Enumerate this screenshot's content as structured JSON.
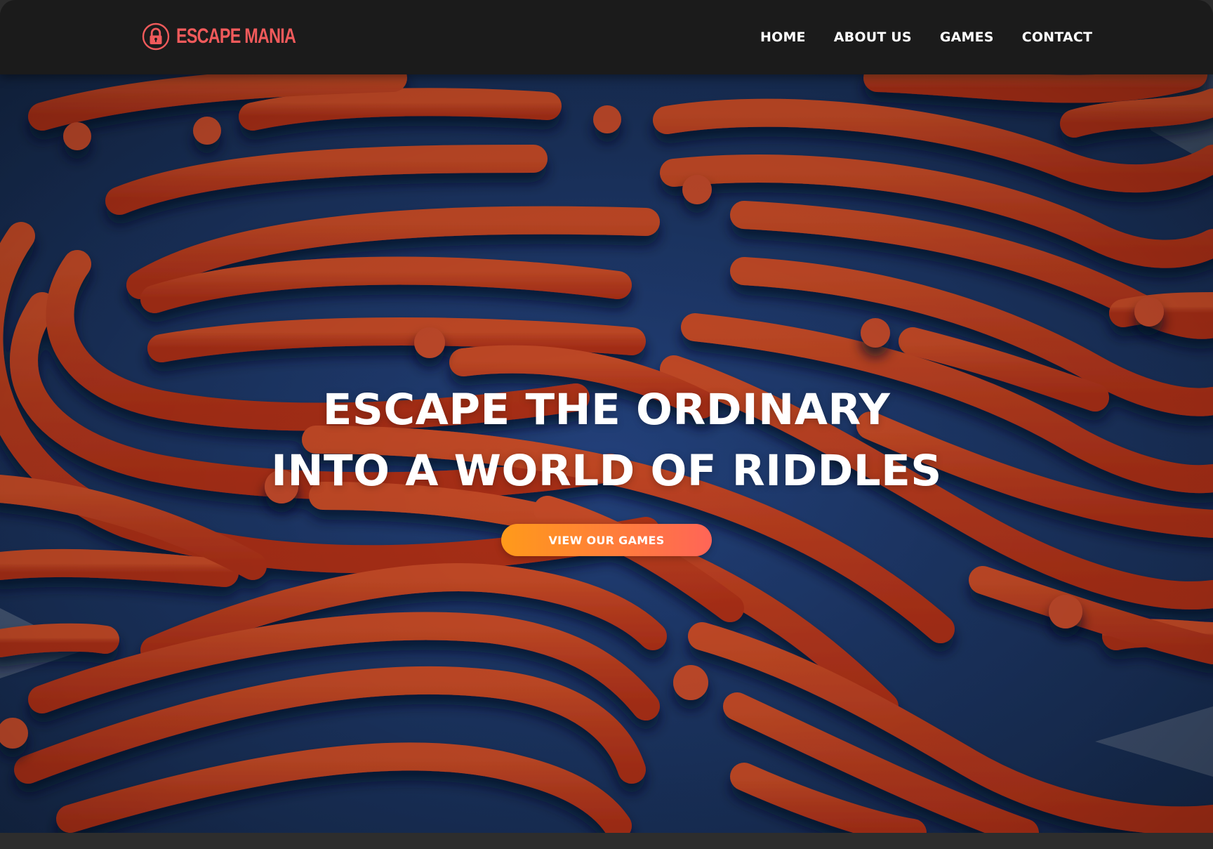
{
  "brand": {
    "name": "ESCAPE MANIA",
    "icon": "padlock-icon",
    "color": "#f05a5b"
  },
  "nav": {
    "items": [
      {
        "label": "HOME"
      },
      {
        "label": "ABOUT US"
      },
      {
        "label": "GAMES"
      },
      {
        "label": "CONTACT"
      }
    ]
  },
  "hero": {
    "background": "maze-fingerprint-pattern",
    "title_line1": "ESCAPE THE ORDINARY",
    "title_line2": "INTO A WORLD OF RIDDLES",
    "cta_label": "VIEW OUR GAMES"
  },
  "colors": {
    "header_bg": "#1b1b1b",
    "maze_top": "#c24a26",
    "maze_wall": "#1f3560",
    "cta_start": "#ff9a1a",
    "cta_end": "#ff6557",
    "footer_strip": "#2d2d2d"
  }
}
